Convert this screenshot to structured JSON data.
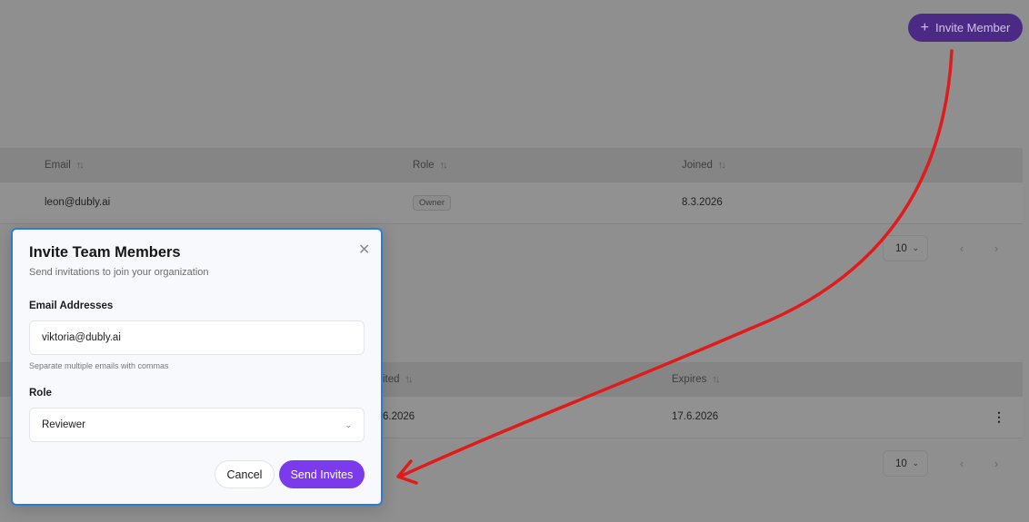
{
  "header": {
    "invite_button_icon": "plus-icon",
    "invite_button_label": "Invite Member"
  },
  "members_table": {
    "columns": [
      "Email",
      "Role",
      "Joined"
    ],
    "rows": [
      {
        "email": "leon@dubly.ai",
        "role": "Owner",
        "joined": "8.3.2026"
      }
    ],
    "page_size": "10"
  },
  "invites_table": {
    "columns": [
      "ited",
      "Expires"
    ],
    "rows": [
      {
        "invited": "6.2026",
        "expires": "17.6.2026"
      }
    ],
    "page_size": "10"
  },
  "modal": {
    "title": "Invite Team Members",
    "subtitle": "Send invitations to join your organization",
    "email_label": "Email Addresses",
    "email_value": "viktoria@dubly.ai",
    "email_hint": "Separate multiple emails with commas",
    "role_label": "Role",
    "role_value": "Reviewer",
    "cancel_label": "Cancel",
    "send_label": "Send Invites"
  },
  "colors": {
    "accent": "#7c3aed",
    "annotation_arrow": "#e01b1b",
    "modal_border": "#2e7bd6"
  }
}
